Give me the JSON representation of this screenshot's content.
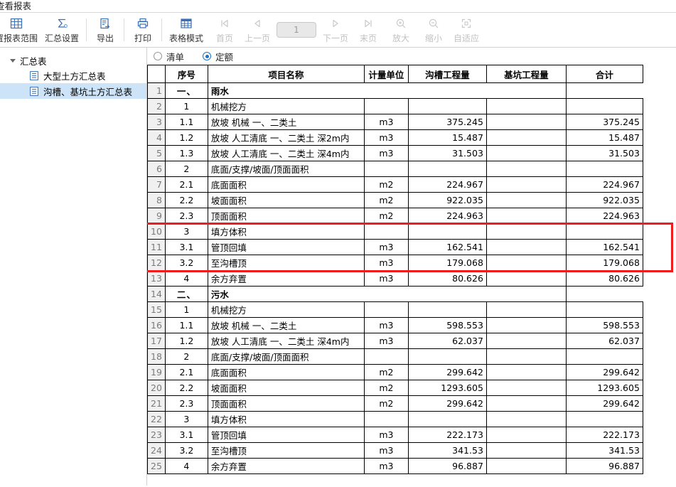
{
  "window": {
    "title": "查看报表"
  },
  "toolbar": {
    "items": [
      {
        "id": "set-report-range",
        "label": "置报表范围",
        "icon": "table-grid-icon",
        "disabled": false
      },
      {
        "id": "summary-settings",
        "label": "汇总设置",
        "icon": "sigma-icon",
        "disabled": false
      },
      {
        "id": "export",
        "label": "导出",
        "icon": "export-icon",
        "disabled": false
      },
      {
        "id": "print",
        "label": "打印",
        "icon": "printer-icon",
        "disabled": false
      },
      {
        "id": "table-mode",
        "label": "表格模式",
        "icon": "table-mode-icon",
        "disabled": false
      },
      {
        "id": "first-page",
        "label": "首页",
        "icon": "first-page-icon",
        "disabled": true
      },
      {
        "id": "prev-page",
        "label": "上一页",
        "icon": "prev-page-icon",
        "disabled": true
      }
    ],
    "page_number": "1",
    "items_right": [
      {
        "id": "next-page",
        "label": "下一页",
        "icon": "next-page-icon",
        "disabled": true
      },
      {
        "id": "last-page",
        "label": "末页",
        "icon": "last-page-icon",
        "disabled": true
      },
      {
        "id": "zoom-in",
        "label": "放大",
        "icon": "zoom-in-icon",
        "disabled": true
      },
      {
        "id": "zoom-out",
        "label": "缩小",
        "icon": "zoom-out-icon",
        "disabled": true
      },
      {
        "id": "fit",
        "label": "自适应",
        "icon": "fit-screen-icon",
        "disabled": true
      }
    ]
  },
  "sidebar": {
    "root_label": "汇总表",
    "items": [
      {
        "label": "大型土方汇总表",
        "selected": false
      },
      {
        "label": "沟槽、基坑土方汇总表",
        "selected": true
      }
    ]
  },
  "mode_radios": [
    {
      "label": "清单",
      "selected": false
    },
    {
      "label": "定额",
      "selected": true
    }
  ],
  "table": {
    "columns": [
      "序号",
      "项目名称",
      "计量单位",
      "沟槽工程量",
      "基坑工程量",
      "合计"
    ],
    "highlight_rows": [
      10,
      11,
      12
    ],
    "rows": [
      {
        "n": "1",
        "no": "一、",
        "name": "雨水",
        "unit": "",
        "a": "",
        "b": "",
        "sum": "",
        "section": true
      },
      {
        "n": "2",
        "no": "1",
        "name": "机械挖方",
        "unit": "",
        "a": "",
        "b": "",
        "sum": ""
      },
      {
        "n": "3",
        "no": "1.1",
        "name": "放坡 机械 一、二类土",
        "unit": "m3",
        "a": "375.245",
        "b": "",
        "sum": "375.245"
      },
      {
        "n": "4",
        "no": "1.2",
        "name": "放坡 人工清底 一、二类土 深2m内",
        "unit": "m3",
        "a": "15.487",
        "b": "",
        "sum": "15.487"
      },
      {
        "n": "5",
        "no": "1.3",
        "name": "放坡 人工清底 一、二类土 深4m内",
        "unit": "m3",
        "a": "31.503",
        "b": "",
        "sum": "31.503"
      },
      {
        "n": "6",
        "no": "2",
        "name": "底面/支撑/坡面/顶面面积",
        "unit": "",
        "a": "",
        "b": "",
        "sum": ""
      },
      {
        "n": "7",
        "no": "2.1",
        "name": "底面面积",
        "unit": "m2",
        "a": "224.967",
        "b": "",
        "sum": "224.967"
      },
      {
        "n": "8",
        "no": "2.2",
        "name": "坡面面积",
        "unit": "m2",
        "a": "922.035",
        "b": "",
        "sum": "922.035"
      },
      {
        "n": "9",
        "no": "2.3",
        "name": "顶面面积",
        "unit": "m2",
        "a": "224.963",
        "b": "",
        "sum": "224.963"
      },
      {
        "n": "10",
        "no": "3",
        "name": "填方体积",
        "unit": "",
        "a": "",
        "b": "",
        "sum": ""
      },
      {
        "n": "11",
        "no": "3.1",
        "name": "管顶回填",
        "unit": "m3",
        "a": "162.541",
        "b": "",
        "sum": "162.541"
      },
      {
        "n": "12",
        "no": "3.2",
        "name": "至沟槽顶",
        "unit": "m3",
        "a": "179.068",
        "b": "",
        "sum": "179.068"
      },
      {
        "n": "13",
        "no": "4",
        "name": "余方弃置",
        "unit": "m3",
        "a": "80.626",
        "b": "",
        "sum": "80.626"
      },
      {
        "n": "14",
        "no": "二、",
        "name": "污水",
        "unit": "",
        "a": "",
        "b": "",
        "sum": "",
        "section": true
      },
      {
        "n": "15",
        "no": "1",
        "name": "机械挖方",
        "unit": "",
        "a": "",
        "b": "",
        "sum": ""
      },
      {
        "n": "16",
        "no": "1.1",
        "name": "放坡 机械 一、二类土",
        "unit": "m3",
        "a": "598.553",
        "b": "",
        "sum": "598.553"
      },
      {
        "n": "17",
        "no": "1.2",
        "name": "放坡 人工清底 一、二类土 深4m内",
        "unit": "m3",
        "a": "62.037",
        "b": "",
        "sum": "62.037"
      },
      {
        "n": "18",
        "no": "2",
        "name": "底面/支撑/坡面/顶面面积",
        "unit": "",
        "a": "",
        "b": "",
        "sum": ""
      },
      {
        "n": "19",
        "no": "2.1",
        "name": "底面面积",
        "unit": "m2",
        "a": "299.642",
        "b": "",
        "sum": "299.642"
      },
      {
        "n": "20",
        "no": "2.2",
        "name": "坡面面积",
        "unit": "m2",
        "a": "1293.605",
        "b": "",
        "sum": "1293.605"
      },
      {
        "n": "21",
        "no": "2.3",
        "name": "顶面面积",
        "unit": "m2",
        "a": "299.642",
        "b": "",
        "sum": "299.642"
      },
      {
        "n": "22",
        "no": "3",
        "name": "填方体积",
        "unit": "",
        "a": "",
        "b": "",
        "sum": ""
      },
      {
        "n": "23",
        "no": "3.1",
        "name": "管顶回填",
        "unit": "m3",
        "a": "222.173",
        "b": "",
        "sum": "222.173"
      },
      {
        "n": "24",
        "no": "3.2",
        "name": "至沟槽顶",
        "unit": "m3",
        "a": "341.53",
        "b": "",
        "sum": "341.53"
      },
      {
        "n": "25",
        "no": "4",
        "name": "余方弃置",
        "unit": "m3",
        "a": "96.887",
        "b": "",
        "sum": "96.887"
      }
    ]
  },
  "colors": {
    "highlight_border": "#ee1c1c",
    "selection_bg": "#cde3f7",
    "accent": "#1673d1"
  }
}
